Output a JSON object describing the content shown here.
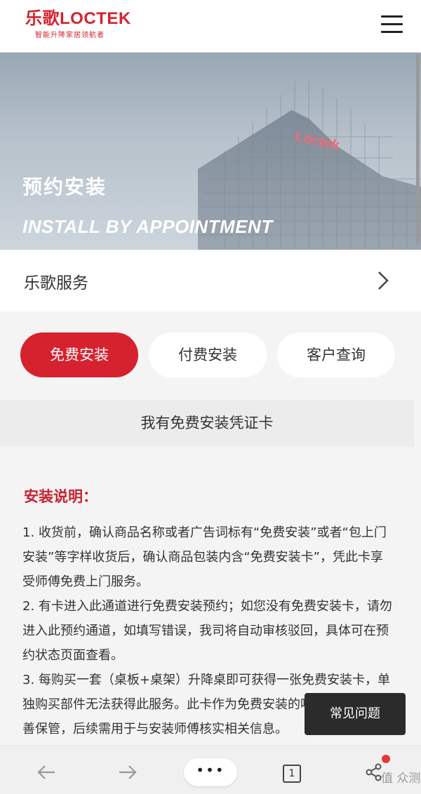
{
  "header": {
    "logo_main": "乐歌LOCTEK",
    "logo_sub": "智能升降家居领航者",
    "menu_icon": "hamburger-menu-icon"
  },
  "banner": {
    "title": "预约安装",
    "subtitle": "INSTALL BY APPOINTMENT",
    "building_sign": "Loctek"
  },
  "service": {
    "label": "乐歌服务",
    "icon": "chevron-right-icon"
  },
  "tabs": [
    {
      "label": "免费安装",
      "active": true
    },
    {
      "label": "付费安装",
      "active": false
    },
    {
      "label": "客户查询",
      "active": false
    }
  ],
  "card_bar": {
    "label": "我有免费安装凭证卡"
  },
  "instructions": {
    "title": "安装说明：",
    "paragraphs": [
      "1. 收货前，确认商品名称或者广告词标有“免费安装”或者“包上门安装”等字样收货后，确认商品包装内含“免费安装卡”，凭此卡享受师傅免费上门服务。",
      "2. 有卡进入此通道进行免费安装预约；如您没有免费安装卡，请勿进入此预约通道，如填写错误，我司将自动审核驳回，具体可在预约状态页面查看。",
      "3. 每购买一套（桌板+桌架）升降桌即可获得一张免费安装卡，单独购买部件无法获得此服务。此卡作为免费安装的唯一凭证，请妥善保管，后续需用于与安装师傅核实相关信息。"
    ]
  },
  "faq_button": {
    "label": "常见问题"
  },
  "browser_bar": {
    "back_icon": "arrow-left-icon",
    "forward_icon": "arrow-right-icon",
    "more_label": "•••",
    "tab_count": "1",
    "share_icon": "share-icon",
    "watermark": "值 众测"
  },
  "colors": {
    "accent": "#d6222e",
    "tab_bg": "#ffffff",
    "page_bg": "#f4f4f4"
  }
}
